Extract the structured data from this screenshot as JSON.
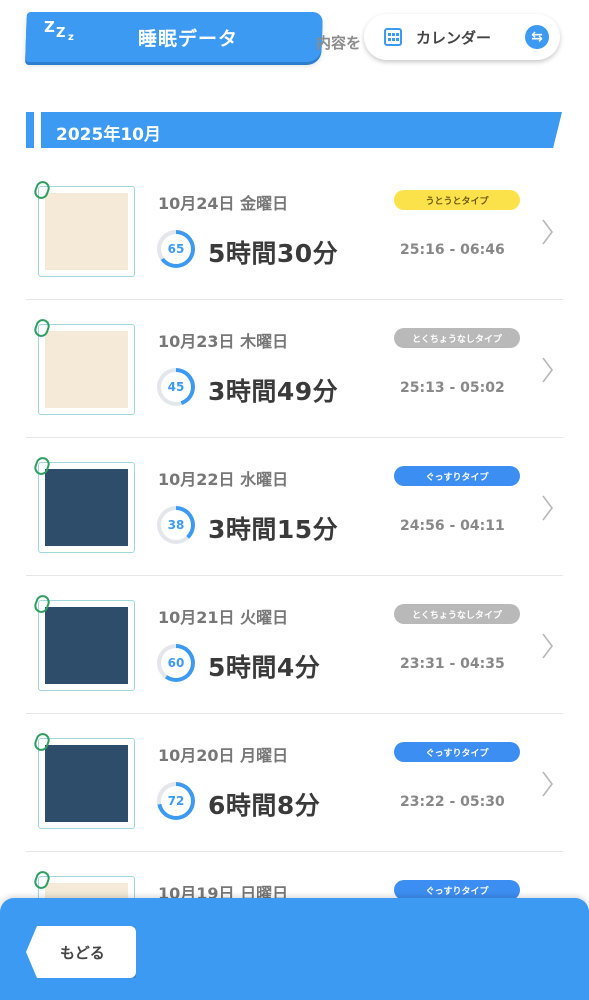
{
  "header": {
    "title": "睡眠データ",
    "behind_text": "内容を",
    "calendar_label": "カレンダー",
    "swap_glyph": "⇆",
    "accent_color": "#3d9af2"
  },
  "month": {
    "label": "2025年10月"
  },
  "records": [
    {
      "date": "10月24日 金曜日",
      "score": "65",
      "duration": "5時間30分",
      "type": "うとうとタイプ",
      "type_color": "yellow",
      "time_range": "25:16 - 06:46",
      "thumb": "light"
    },
    {
      "date": "10月23日 木曜日",
      "score": "45",
      "duration": "3時間49分",
      "type": "とくちょうなしタイプ",
      "type_color": "gray",
      "time_range": "25:13 - 05:02",
      "thumb": "light"
    },
    {
      "date": "10月22日 水曜日",
      "score": "38",
      "duration": "3時間15分",
      "type": "ぐっすりタイプ",
      "type_color": "blue",
      "time_range": "24:56 - 04:11",
      "thumb": "dark"
    },
    {
      "date": "10月21日 火曜日",
      "score": "60",
      "duration": "5時間4分",
      "type": "とくちょうなしタイプ",
      "type_color": "gray",
      "time_range": "23:31 - 04:35",
      "thumb": "dark"
    },
    {
      "date": "10月20日 月曜日",
      "score": "72",
      "duration": "6時間8分",
      "type": "ぐっすりタイプ",
      "type_color": "blue",
      "time_range": "23:22 - 05:30",
      "thumb": "dark"
    },
    {
      "date": "10月19日 日曜日",
      "score": "",
      "duration": "",
      "type": "ぐっすりタイプ",
      "type_color": "blue",
      "time_range": "",
      "thumb": "light"
    }
  ],
  "footer": {
    "back_label": "もどる"
  }
}
